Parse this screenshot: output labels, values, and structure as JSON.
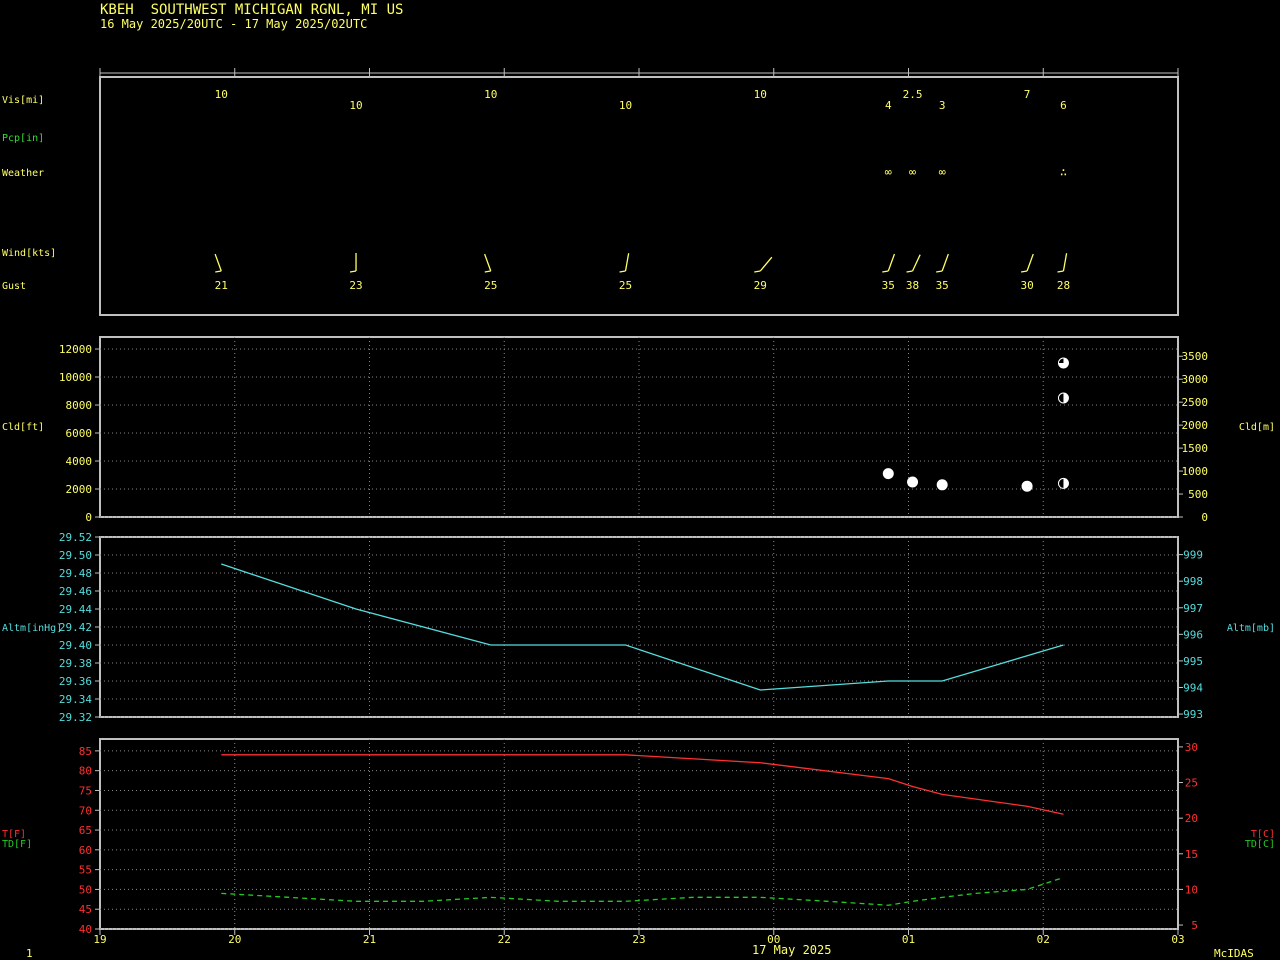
{
  "header": {
    "station": "KBEH  SOUTHWEST MICHIGAN RGNL, MI US",
    "period": "16 May 2025/20UTC - 17 May 2025/02UTC"
  },
  "footer": {
    "date_label": "17 May 2025",
    "left_mark": "1",
    "brand": "McIDAS"
  },
  "colors": {
    "background": "#000000",
    "frame": "#c0c0c0",
    "grid": "#888888",
    "label_yellow": "#ffff66",
    "label_green": "#33dd33",
    "altimeter": "#55dddd",
    "temperature": "#ff3030",
    "dewpoint": "#22cc22",
    "cloud_marker": "#ffffff"
  },
  "time_axis": {
    "hour_labels": [
      "19",
      "20",
      "21",
      "22",
      "23",
      "00",
      "01",
      "02",
      "03"
    ]
  },
  "chart_data": [
    {
      "type": "table",
      "name": "surface-observations",
      "row_labels": {
        "vis": "Vis[mi]",
        "pcp": "Pcp[in]",
        "weather": "Weather",
        "wind": "Wind[kts]",
        "gust": "Gust"
      },
      "observations": [
        {
          "t": 19.9,
          "vis": "10",
          "wx": "",
          "wind_dir": 340,
          "gust": "21"
        },
        {
          "t": 20.9,
          "vis": "10",
          "wx": "",
          "wind_dir": 360,
          "gust": "23"
        },
        {
          "t": 21.9,
          "vis": "10",
          "wx": "",
          "wind_dir": 340,
          "gust": "25"
        },
        {
          "t": 22.9,
          "vis": "10",
          "wx": "",
          "wind_dir": 10,
          "gust": "25"
        },
        {
          "t": 23.9,
          "vis": "10",
          "wx": "",
          "wind_dir": 40,
          "gust": "29"
        },
        {
          "t": 24.85,
          "vis": "4",
          "wx": "∞",
          "wind_dir": 20,
          "gust": "35"
        },
        {
          "t": 25.03,
          "vis": "2.5",
          "wx": "∞",
          "wind_dir": 25,
          "gust": "38"
        },
        {
          "t": 25.25,
          "vis": "3",
          "wx": "∞",
          "wind_dir": 20,
          "gust": "35"
        },
        {
          "t": 25.88,
          "vis": "7",
          "wx": "",
          "wind_dir": 20,
          "gust": "30"
        },
        {
          "t": 26.15,
          "vis": "6",
          "wx": "∴",
          "wind_dir": 10,
          "gust": "28"
        }
      ]
    },
    {
      "type": "scatter",
      "name": "cloud-heights",
      "ylabel_left": "Cld[ft]",
      "ylabel_right": "Cld[m]",
      "ylim": [
        0,
        12800
      ],
      "yticks_left": [
        0,
        2000,
        4000,
        6000,
        8000,
        10000,
        12000
      ],
      "ylim_right": [
        0,
        3900
      ],
      "yticks_right": [
        0,
        500,
        1000,
        1500,
        2000,
        2500,
        3000,
        3500
      ],
      "points": [
        {
          "t": 24.85,
          "ft": 3100,
          "cover": "overcast"
        },
        {
          "t": 25.03,
          "ft": 2500,
          "cover": "overcast"
        },
        {
          "t": 25.25,
          "ft": 2300,
          "cover": "overcast"
        },
        {
          "t": 25.88,
          "ft": 2200,
          "cover": "overcast"
        },
        {
          "t": 26.15,
          "ft": 2400,
          "cover": "scattered"
        },
        {
          "t": 26.15,
          "ft": 8500,
          "cover": "scattered"
        },
        {
          "t": 26.15,
          "ft": 11000,
          "cover": "broken"
        }
      ]
    },
    {
      "type": "line",
      "name": "altimeter",
      "ylabel_left": "Altm[inHg]",
      "ylabel_right": "Altm[mb]",
      "ylim": [
        29.32,
        29.52
      ],
      "yticks_left": [
        29.32,
        29.34,
        29.36,
        29.38,
        29.4,
        29.42,
        29.44,
        29.46,
        29.48,
        29.5,
        29.52
      ],
      "yticks_right": [
        993,
        994,
        995,
        996,
        997,
        998,
        999
      ],
      "x": [
        19.9,
        20.9,
        21.9,
        22.9,
        23.9,
        24.85,
        25.25,
        26.15
      ],
      "values": [
        29.49,
        29.44,
        29.4,
        29.4,
        29.35,
        29.36,
        29.36,
        29.4
      ]
    },
    {
      "type": "line",
      "name": "temperature-dewpoint",
      "ylabel_left": "T[F]",
      "ylabel_left_2": "TD[F]",
      "ylabel_right": "T[C]",
      "ylabel_right_2": "TD[C]",
      "ylim": [
        40,
        88
      ],
      "yticks_left": [
        40,
        45,
        50,
        55,
        60,
        65,
        70,
        75,
        80,
        85
      ],
      "yticks_right": [
        5,
        10,
        15,
        20,
        25,
        30
      ],
      "series": [
        {
          "key": "T",
          "x": [
            19.9,
            20.9,
            21.9,
            22.9,
            23.9,
            24.85,
            25.03,
            25.25,
            25.88,
            26.15
          ],
          "values": [
            84,
            84,
            84,
            84,
            82,
            78,
            76,
            74,
            71,
            69
          ]
        },
        {
          "key": "TD",
          "x": [
            19.9,
            20.4,
            20.9,
            21.4,
            21.9,
            22.4,
            22.9,
            23.4,
            23.9,
            24.4,
            24.85,
            25.03,
            25.25,
            25.5,
            25.88,
            26.15
          ],
          "values": [
            49,
            48,
            47,
            47,
            48,
            47,
            47,
            48,
            48,
            47,
            46,
            47,
            48,
            49,
            50,
            53
          ]
        }
      ]
    }
  ]
}
